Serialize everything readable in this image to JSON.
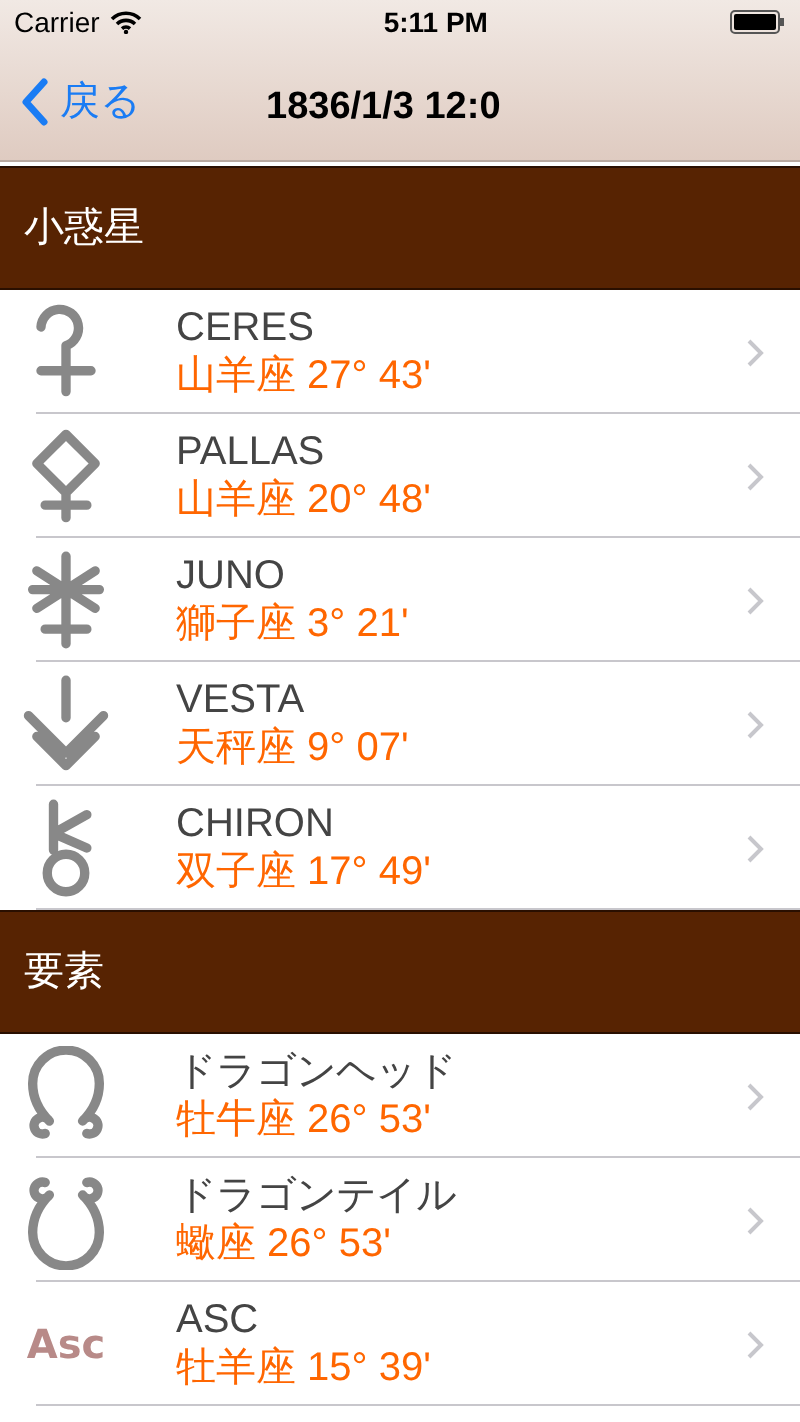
{
  "status_bar": {
    "carrier": "Carrier",
    "time": "5:11 PM"
  },
  "nav_bar": {
    "back": "戻る",
    "title": "1836/1/3 12:0"
  },
  "sections": [
    {
      "title": "小惑星",
      "rows": [
        {
          "kind": "ceres",
          "name": "CERES",
          "position": "山羊座 27° 43'"
        },
        {
          "kind": "pallas",
          "name": "PALLAS",
          "position": "山羊座 20° 48'"
        },
        {
          "kind": "juno",
          "name": "JUNO",
          "position": "獅子座 3° 21'"
        },
        {
          "kind": "vesta",
          "name": "VESTA",
          "position": "天秤座 9° 07'"
        },
        {
          "kind": "chiron",
          "name": "CHIRON",
          "position": "双子座 17° 49'"
        }
      ]
    },
    {
      "title": "要素",
      "rows": [
        {
          "kind": "north_node",
          "name": "ドラゴンヘッド",
          "position": "牡牛座 26° 53'"
        },
        {
          "kind": "south_node",
          "name": "ドラゴンテイル",
          "position": "蠍座 26° 53'"
        },
        {
          "kind": "text",
          "symbol": "Asc",
          "name": "ASC",
          "position": "牡羊座 15° 39'"
        }
      ]
    }
  ]
}
